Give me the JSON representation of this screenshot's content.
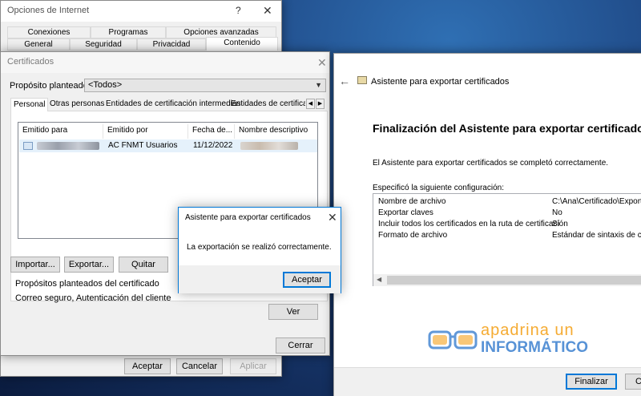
{
  "inet": {
    "title": "Opciones de Internet",
    "help": "?",
    "close": "✕",
    "tabs_top": [
      "Conexiones",
      "Programas",
      "Opciones avanzadas"
    ],
    "tabs_bottom": [
      "General",
      "Seguridad",
      "Privacidad",
      "Contenido"
    ],
    "buttons": {
      "ok": "Aceptar",
      "cancel": "Cancelar",
      "apply": "Aplicar"
    }
  },
  "cert": {
    "title": "Certificados",
    "close": "✕",
    "purpose_label": "Propósito planteado:",
    "purpose_value": "<Todos>",
    "tabs": [
      "Personal",
      "Otras personas",
      "Entidades de certificación intermedias",
      "Entidades de certificac"
    ],
    "columns": [
      "Emitido para",
      "Emitido por",
      "Fecha de...",
      "Nombre descriptivo"
    ],
    "rows": [
      {
        "issued_by": "AC FNMT Usuarios",
        "date": "11/12/2022"
      }
    ],
    "buttons": {
      "import": "Importar...",
      "export": "Exportar...",
      "remove": "Quitar",
      "view": "Ver",
      "close": "Cerrar"
    },
    "purposes_heading": "Propósitos planteados del certificado",
    "purposes_value": "Correo seguro, Autenticación del cliente"
  },
  "dialog": {
    "title": "Asistente para exportar certificados",
    "close": "✕",
    "message": "La exportación se realizó correctamente.",
    "ok": "Aceptar"
  },
  "wizard": {
    "back": "←",
    "title": "Asistente para exportar certificados",
    "heading": "Finalización del Asistente para exportar certificados",
    "success": "El Asistente para exportar certificados se completó correctamente.",
    "config_label": "Especificó la siguiente configuración:",
    "settings": [
      {
        "key": "Nombre de archivo",
        "value": "C:\\Ana\\Certificado\\Exportar"
      },
      {
        "key": "Exportar claves",
        "value": "No"
      },
      {
        "key": "Incluir todos los certificados en la ruta de certificación",
        "value": "Sí"
      },
      {
        "key": "Formato de archivo",
        "value": "Estándar de sintaxis de cifrad"
      }
    ],
    "finish": "Finalizar",
    "cancel": "Ca"
  },
  "logo": {
    "line1": "apadrina un",
    "line2": "INFORMÁTICO"
  },
  "colors": {
    "accent": "#0078d7",
    "logo_orange": "#f4a21c",
    "logo_blue": "#3a7fcf"
  }
}
